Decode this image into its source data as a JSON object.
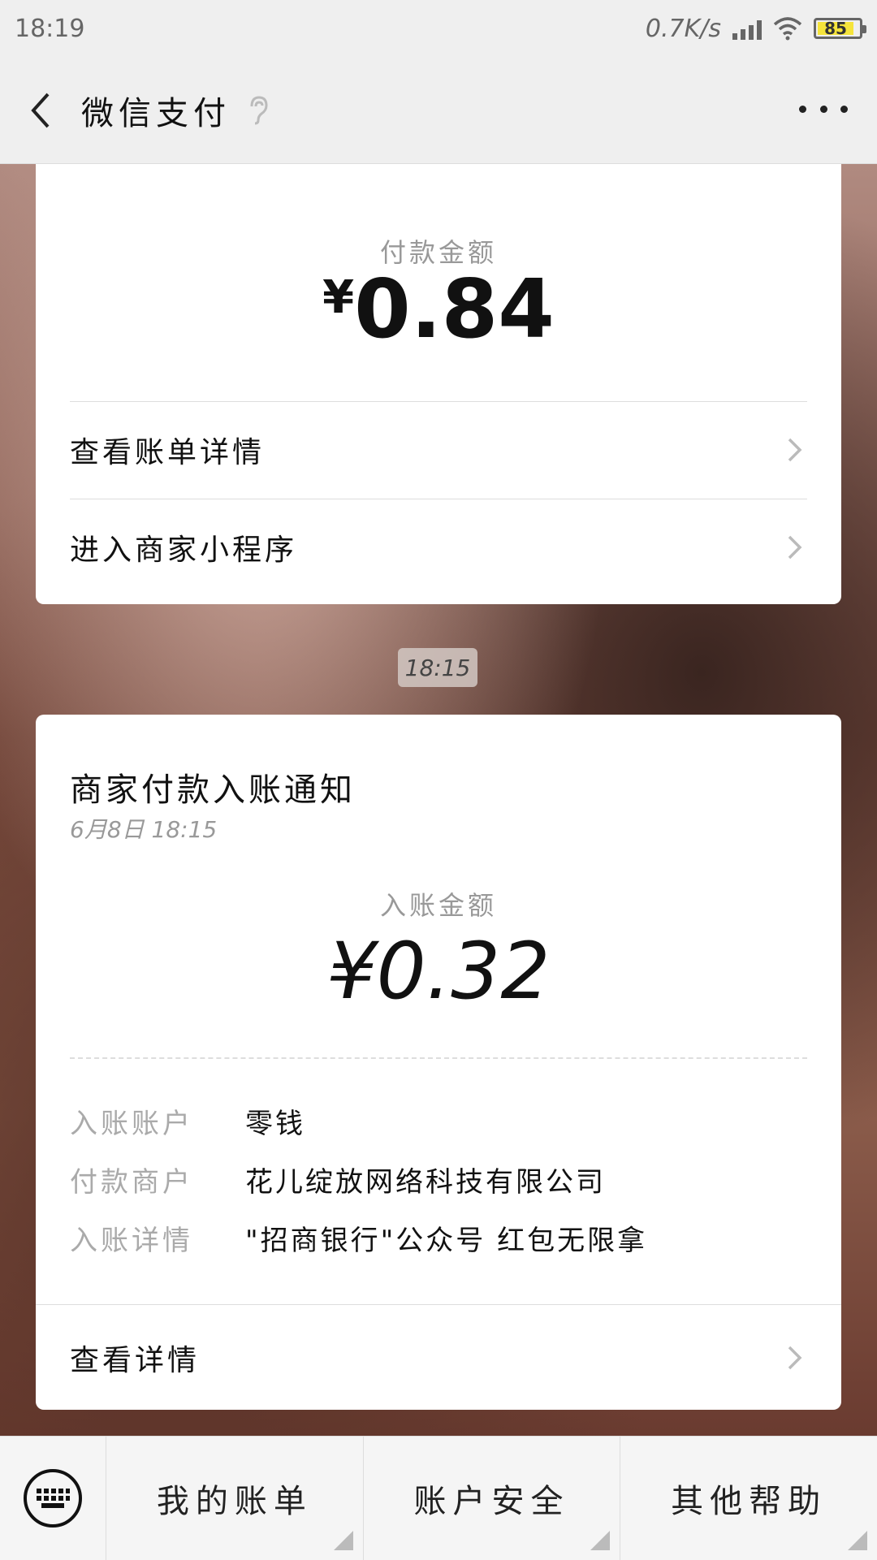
{
  "status": {
    "time": "18:19",
    "speed": "0.7K/s",
    "battery": "85"
  },
  "header": {
    "title": "微信支付"
  },
  "card1": {
    "amount_label": "付款金额",
    "amount_currency": "¥",
    "amount_value": "0.84",
    "rows": [
      {
        "label": "查看账单详情"
      },
      {
        "label": "进入商家小程序"
      }
    ]
  },
  "timestamp": "18:15",
  "card2": {
    "title": "商家付款入账通知",
    "date": "6月8日  18:15",
    "amount_label": "入账金额",
    "amount": "¥0.32",
    "details": [
      {
        "key": "入账账户",
        "value": "零钱"
      },
      {
        "key": "付款商户",
        "value": "花儿绽放网络科技有限公司"
      },
      {
        "key": "入账详情",
        "value": "\"招商银行\"公众号 红包无限拿"
      }
    ],
    "footer_label": "查看详情"
  },
  "bottom_menu": [
    {
      "label": "我的账单"
    },
    {
      "label": "账户安全"
    },
    {
      "label": "其他帮助"
    }
  ],
  "colors": {
    "card_bg": "#ffffff",
    "bar_bg": "#efefef",
    "battery_fill": "#f5e43b"
  }
}
